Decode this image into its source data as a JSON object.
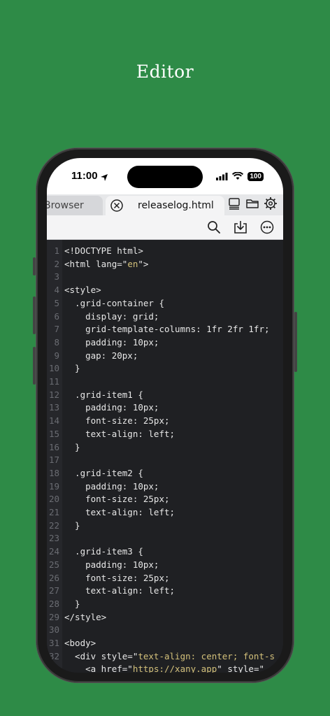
{
  "page": {
    "title": "Editor"
  },
  "status_bar": {
    "time": "11:00",
    "battery": "100"
  },
  "tabs": [
    {
      "label": "Browser"
    },
    {
      "label": "releaselog.html"
    }
  ],
  "icons": {
    "close": "close-icon",
    "panel": "panel-icon",
    "folder": "folder-icon",
    "settings": "settings-icon",
    "search": "search-icon",
    "download": "download-icon",
    "more": "more-icon"
  },
  "colors": {
    "background": "#2e8b47",
    "editor_bg": "#1f2023",
    "string": "#d3c07a"
  },
  "code_lines": [
    {
      "n": "1",
      "text": "<!DOCTYPE html>"
    },
    {
      "n": "2",
      "text": "<html lang=\"",
      "str": "en",
      "after": "\">"
    },
    {
      "n": "3",
      "text": ""
    },
    {
      "n": "4",
      "text": "<style>"
    },
    {
      "n": "5",
      "text": "  .grid-container {"
    },
    {
      "n": "6",
      "text": "    display: grid;"
    },
    {
      "n": "7",
      "text": "    grid-template-columns: 1fr 2fr 1fr;"
    },
    {
      "n": "8",
      "text": "    padding: 10px;"
    },
    {
      "n": "9",
      "text": "    gap: 20px;"
    },
    {
      "n": "10",
      "text": "  }"
    },
    {
      "n": "11",
      "text": ""
    },
    {
      "n": "12",
      "text": "  .grid-item1 {"
    },
    {
      "n": "13",
      "text": "    padding: 10px;"
    },
    {
      "n": "14",
      "text": "    font-size: 25px;"
    },
    {
      "n": "15",
      "text": "    text-align: left;"
    },
    {
      "n": "16",
      "text": "  }"
    },
    {
      "n": "17",
      "text": ""
    },
    {
      "n": "18",
      "text": "  .grid-item2 {"
    },
    {
      "n": "19",
      "text": "    padding: 10px;"
    },
    {
      "n": "20",
      "text": "    font-size: 25px;"
    },
    {
      "n": "21",
      "text": "    text-align: left;"
    },
    {
      "n": "22",
      "text": "  }"
    },
    {
      "n": "23",
      "text": ""
    },
    {
      "n": "24",
      "text": "  .grid-item3 {"
    },
    {
      "n": "25",
      "text": "    padding: 10px;"
    },
    {
      "n": "26",
      "text": "    font-size: 25px;"
    },
    {
      "n": "27",
      "text": "    text-align: left;"
    },
    {
      "n": "28",
      "text": "  }"
    },
    {
      "n": "29",
      "text": "</style>"
    },
    {
      "n": "30",
      "text": ""
    },
    {
      "n": "31",
      "text": "<body>"
    },
    {
      "n": "32",
      "text": "  <div style=\"",
      "str": "text-align: center; font-s",
      "after": ""
    },
    {
      "n": "",
      "text": "    <a href=\"",
      "str": "https://xany.app",
      "after": "\" style=\""
    }
  ]
}
